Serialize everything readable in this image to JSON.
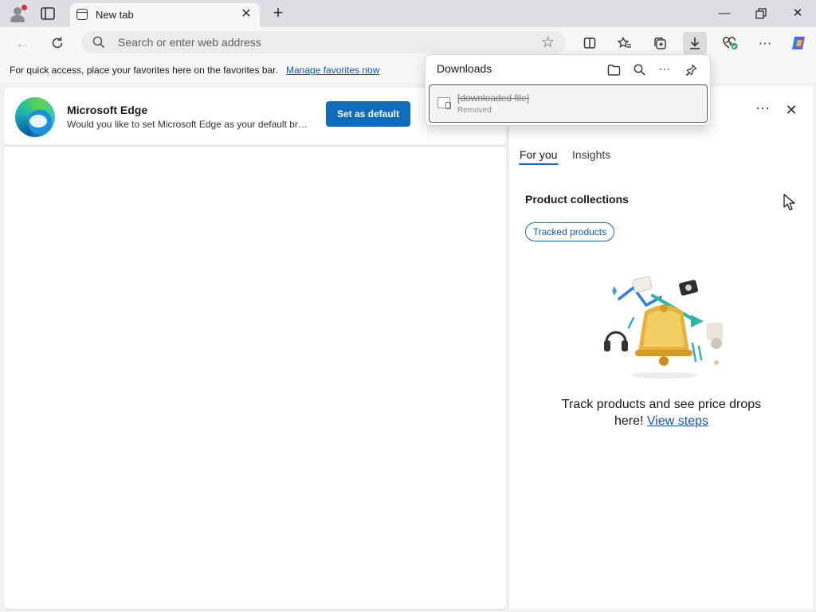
{
  "tab": {
    "title": "New tab"
  },
  "address": {
    "placeholder": "Search or enter web address"
  },
  "favorites_bar": {
    "message": "For quick access, place your favorites here on the favorites bar.",
    "link": "Manage favorites now"
  },
  "banner": {
    "name": "Microsoft Edge",
    "description": "Would you like to set Microsoft Edge as your default browser?",
    "button": "Set as default"
  },
  "downloads": {
    "title": "Downloads",
    "items": [
      {
        "name": "[downloaded file]",
        "status": "Removed"
      }
    ]
  },
  "side_panel": {
    "tabs": [
      "For you",
      "Insights"
    ],
    "section_title": "Product collections",
    "chip": "Tracked products",
    "message": "Track products and see price drops here!",
    "link": "View steps"
  },
  "colors": {
    "accent": "#0f6cbd",
    "link": "#0f5ab8"
  }
}
